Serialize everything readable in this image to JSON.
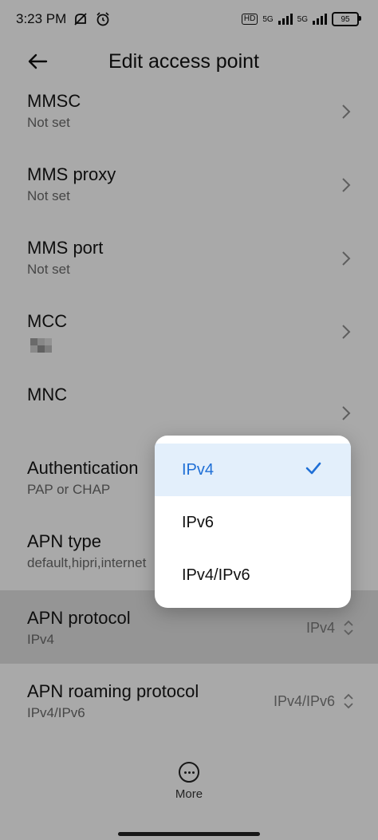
{
  "status_bar": {
    "time": "3:23 PM",
    "network1": "5G",
    "network2": "5G",
    "hd": "HD",
    "battery": "95"
  },
  "header": {
    "title": "Edit access point"
  },
  "items": [
    {
      "label": "MMSC",
      "value": "Not set"
    },
    {
      "label": "MMS proxy",
      "value": "Not set"
    },
    {
      "label": "MMS port",
      "value": "Not set"
    },
    {
      "label": "MCC",
      "value": ""
    },
    {
      "label": "MNC",
      "value": ""
    },
    {
      "label": "Authentication",
      "value": "PAP or CHAP"
    },
    {
      "label": "APN type",
      "value": "default,hipri,internet"
    },
    {
      "label": "APN protocol",
      "value": "IPv4",
      "current": "IPv4"
    },
    {
      "label": "APN roaming protocol",
      "value": "IPv4/IPv6",
      "current": "IPv4/IPv6"
    }
  ],
  "popup": {
    "options": [
      "IPv4",
      "IPv6",
      "IPv4/IPv6"
    ],
    "selected": "IPv4",
    "accent": "#1f6fd6"
  },
  "bottom": {
    "more_label": "More"
  }
}
